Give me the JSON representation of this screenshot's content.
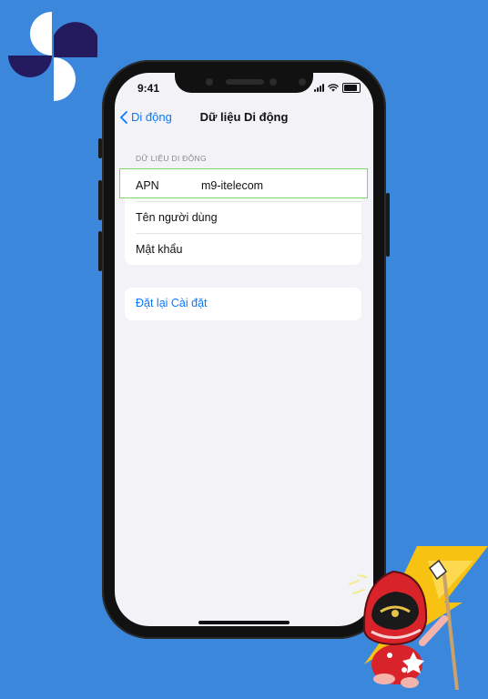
{
  "status_bar": {
    "time": "9:41"
  },
  "nav": {
    "back_label": "Di động",
    "title": "Dữ liệu Di động"
  },
  "cellular_data": {
    "section_header": "DỮ LIỆU DI ĐỘNG",
    "rows": [
      {
        "label": "APN",
        "value": "m9-itelecom"
      },
      {
        "label": "Tên người dùng",
        "value": ""
      },
      {
        "label": "Mật khẩu",
        "value": ""
      }
    ]
  },
  "reset": {
    "label": "Đặt lại Cài đặt"
  },
  "icons": {
    "back": "chevron-left-icon",
    "signal": "cellular-signal-icon",
    "wifi": "wifi-icon",
    "battery": "battery-icon"
  },
  "colors": {
    "background": "#3b87db",
    "screen": "#f2f2f7",
    "accent": "#0a7aff",
    "highlight_border": "#7ed46d",
    "logo_dark": "#231b5e",
    "mascot_red": "#d8232a",
    "lightning": "#f7c212"
  }
}
